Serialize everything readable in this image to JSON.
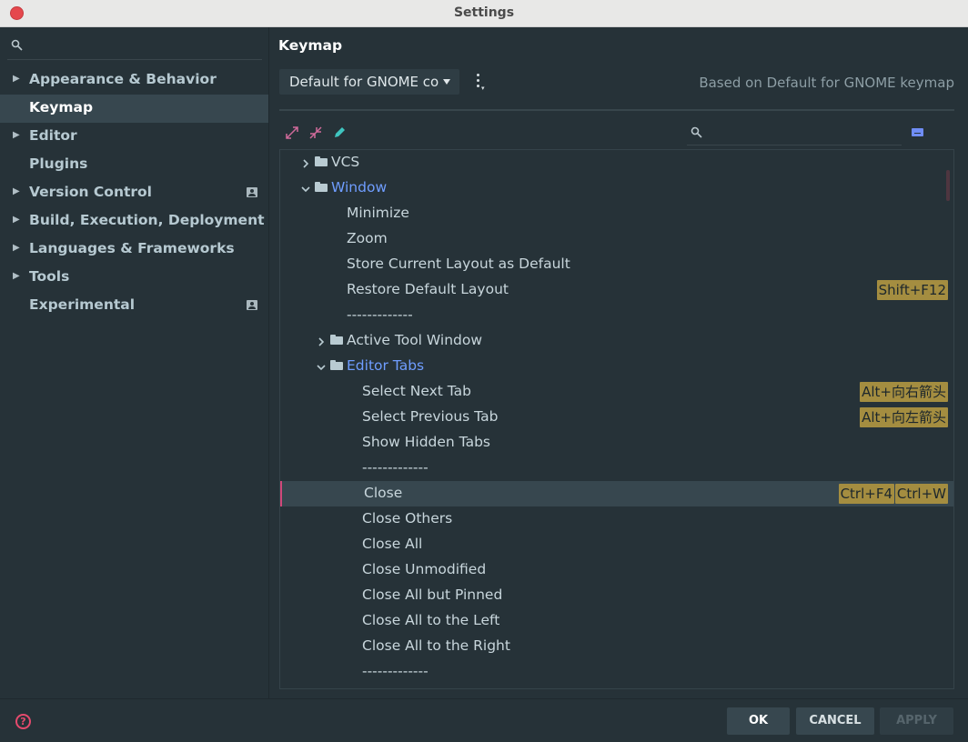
{
  "window": {
    "title": "Settings"
  },
  "sidebar": {
    "items": [
      {
        "label": "Appearance & Behavior",
        "expandable": true
      },
      {
        "label": "Keymap",
        "selected": true
      },
      {
        "label": "Editor",
        "expandable": true
      },
      {
        "label": "Plugins"
      },
      {
        "label": "Version Control",
        "expandable": true,
        "badge": true
      },
      {
        "label": "Build, Execution, Deployment",
        "expandable": true
      },
      {
        "label": "Languages & Frameworks",
        "expandable": true
      },
      {
        "label": "Tools",
        "expandable": true
      },
      {
        "label": "Experimental",
        "badge": true
      }
    ]
  },
  "main": {
    "title": "Keymap",
    "keymap_select_value": "Default for GNOME copy",
    "based_on": "Based on Default for GNOME keymap"
  },
  "tree": [
    {
      "label": "VCS",
      "type": "folder",
      "expanded": false
    },
    {
      "label": "Window",
      "type": "folder",
      "expanded": true
    },
    {
      "label": "Minimize"
    },
    {
      "label": "Zoom"
    },
    {
      "label": "Store Current Layout as Default"
    },
    {
      "label": "Restore Default Layout",
      "shortcuts": [
        "Shift+F12"
      ]
    },
    {
      "label": "-------------"
    },
    {
      "label": "Active Tool Window",
      "type": "folder",
      "expanded": false
    },
    {
      "label": "Editor Tabs",
      "type": "folder",
      "expanded": true
    },
    {
      "label": "Select Next Tab",
      "shortcuts": [
        "Alt+向右箭头"
      ]
    },
    {
      "label": "Select Previous Tab",
      "shortcuts": [
        "Alt+向左箭头"
      ]
    },
    {
      "label": "Show Hidden Tabs"
    },
    {
      "label": "-------------"
    },
    {
      "label": "Close",
      "shortcuts": [
        "Ctrl+F4",
        "Ctrl+W"
      ],
      "selected": true
    },
    {
      "label": "Close Others"
    },
    {
      "label": "Close All"
    },
    {
      "label": "Close Unmodified"
    },
    {
      "label": "Close All but Pinned"
    },
    {
      "label": "Close All to the Left"
    },
    {
      "label": "Close All to the Right"
    },
    {
      "label": "-------------"
    }
  ],
  "buttons": {
    "ok": "OK",
    "cancel": "CANCEL",
    "apply": "APPLY"
  },
  "colors": {
    "background": "#263238",
    "selection": "#37474f",
    "accent_blue": "#6f9dff",
    "shortcut_bg": "#a48d40",
    "accent_pink": "#d0487a"
  }
}
